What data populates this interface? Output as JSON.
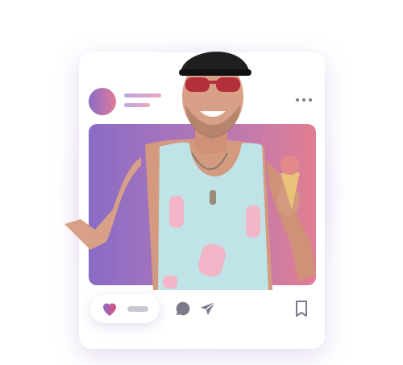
{
  "post": {
    "header": {
      "avatar_gradient": [
        "#8a6cc6",
        "#e07a9a"
      ],
      "more_icon": "more-horizontal-icon"
    },
    "photo": {
      "gradient": [
        "#8a6cc6",
        "#e27e94"
      ]
    },
    "actions": {
      "like_icon": "heart-icon",
      "comment_icon": "comment-bubble-icon",
      "share_icon": "paper-plane-icon",
      "save_icon": "bookmark-icon"
    }
  },
  "colors": {
    "accent_purple": "#8a6cc6",
    "accent_pink": "#e07a9a",
    "icon_gray": "#7a7a8a"
  }
}
